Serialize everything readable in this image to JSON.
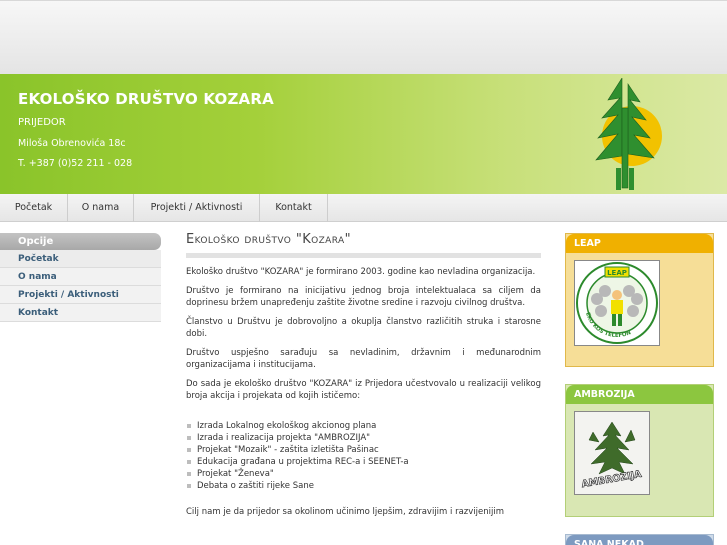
{
  "header": {
    "org_name": "EKOLOŠKO DRUŠTVO KOZARA",
    "city": "PRIJEDOR",
    "street": "Miloša Obrenovića 18c",
    "phone": "T. +387 (0)52 211 - 028",
    "logo_icon": "fir-tree-sun-logo"
  },
  "nav": {
    "items": [
      "Početak",
      "O nama",
      "Projekti / Aktivnosti",
      "Kontakt"
    ]
  },
  "sidebar": {
    "heading": "Opcije",
    "items": [
      "Početak",
      "O nama",
      "Projekti / Aktivnosti",
      "Kontakt"
    ]
  },
  "content": {
    "title": "Ekološko društvo \"Kozara\"",
    "paragraphs": [
      "Ekološko društvo \"KOZARA\" je formirano 2003. godine kao nevladina organizacija.",
      "Društvo je formirano na inicijativu jednog broja intelektualaca sa ciljem da doprinesu bržem unapređenju zaštite životne sredine i razvoju civilnog društva.",
      "Članstvo u Društvu je dobrovoljno a okuplja članstvo različitih struka i starosne dobi.",
      "Društvo uspješno sarađuju sa nevladinim, državnim i međunarodnim organizacijama i institucijama.",
      "Do sada je ekološko društvo \"KOZARA\" iz Prijedora učestvovalo u realizaciji velikog broja akcija i projekata od kojih ističemo:"
    ],
    "list": [
      "Izrada Lokalnog ekološkog akcionog plana",
      "Izrada i realizacija projekta \"AMBROZIJA\"",
      "Projekat \"Mozaik\" - zaštita izletišta Pašinac",
      "Edukacija građana u projektima REC-a i SEENET-a",
      "Projekat \"Ženeva\"",
      "Debata o zaštiti rijeke Sane"
    ],
    "trailing": "Cilj nam je da prijedor sa okolinom učinimo ljepšim, zdravijim i razvijenijim"
  },
  "right": {
    "leap": {
      "heading": "LEAP",
      "logo_text": "LEAP",
      "ring_text": "EKO KOS TELEFON"
    },
    "ambrozija": {
      "heading": "AMBROZIJA",
      "image_text": "AMBROZIJA"
    },
    "sana": {
      "heading": "SANA NEKAD"
    }
  },
  "colors": {
    "banner_green": "#8ac42a",
    "leap_orange": "#f0b000",
    "ambrozija_green": "#8cc63f",
    "sana_blue": "#7d9ac0",
    "link_blue": "#3b5e7a"
  }
}
